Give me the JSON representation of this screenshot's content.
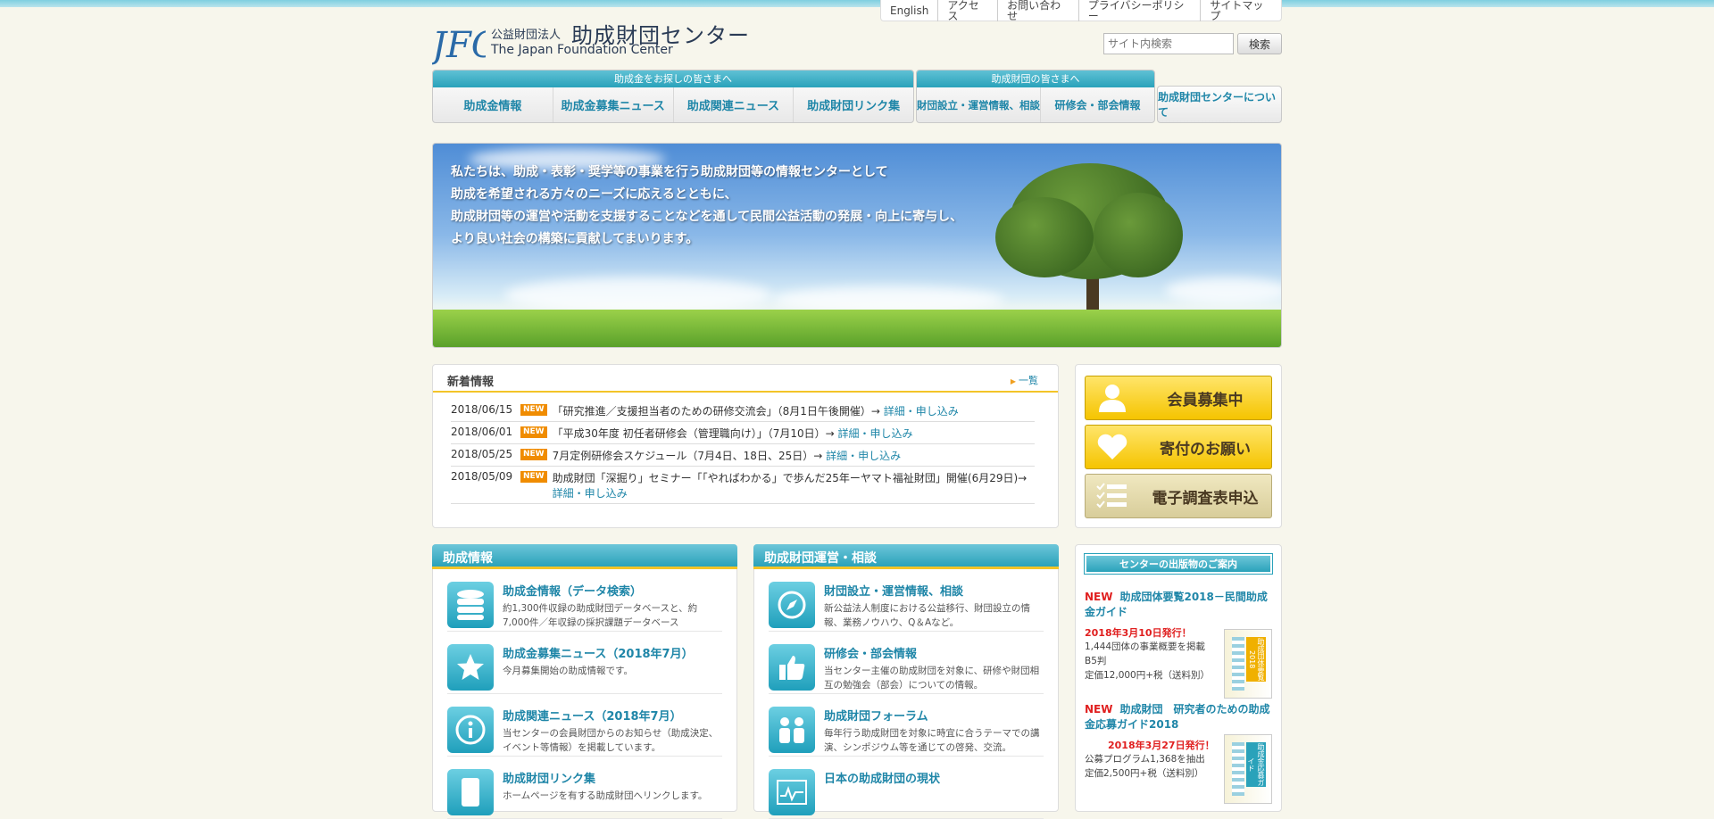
{
  "header": {
    "logo_mark": "JFC",
    "org_small": "公益財団法人",
    "org_name": "助成財団センター",
    "org_en": "The Japan Foundation Center",
    "utility_links": [
      "English",
      "アクセス",
      "お問い合わせ",
      "プライバシーポリシー",
      "サイトマップ"
    ],
    "search_placeholder": "サイト内検索",
    "search_button": "検索"
  },
  "nav": {
    "group1_caption": "助成金をお探しの皆さまへ",
    "group1_items": [
      "助成金情報",
      "助成金募集ニュース",
      "助成関連ニュース",
      "助成財団リンク集"
    ],
    "group2_caption": "助成財団の皆さまへ",
    "group2_items": [
      "財団設立・運営情報、相談",
      "研修会・部会情報"
    ],
    "about": "助成財団センターについて"
  },
  "hero": {
    "lines": [
      "私たちは、助成・表彰・奨学等の事業を行う助成財団等の情報センターとして",
      "助成を希望される方々のニーズに応えるとともに、",
      "助成財団等の運営や活動を支援することなどを通して民間公益活動の発展・向上に寄与し、",
      "より良い社会の構築に貢献してまいります。"
    ]
  },
  "news": {
    "title": "新着情報",
    "more": "一覧",
    "new_label": "NEW",
    "items": [
      {
        "date": "2018/06/15",
        "text": "「研究推進／支援担当者のための研修交流会」（8月1日午後開催）→",
        "link": "詳細・申し込み"
      },
      {
        "date": "2018/06/01",
        "text": "「平成30年度 初任者研修会（管理職向け）」（7月10日）→",
        "link": "詳細・申し込み"
      },
      {
        "date": "2018/05/25",
        "text": "7月定例研修会スケジュール（7月4日、18日、25日）→",
        "link": "詳細・申し込み"
      },
      {
        "date": "2018/05/09",
        "text": "助成財団「深掘り」セミナー「「やればわかる」で歩んだ25年ーヤマト福祉財団」開催(6月29日)→",
        "link": "詳細・申し込み"
      }
    ]
  },
  "side_buttons": [
    "会員募集中",
    "寄付のお願い",
    "電子調査表申込"
  ],
  "section_grant": {
    "title": "助成情報",
    "entries": [
      {
        "title": "助成金情報（データ検索）",
        "desc": "約1,300件収録の助成財団データベースと、約7,000件／年収録の採択課題データベース"
      },
      {
        "title": "助成金募集ニュース（2018年7月）",
        "desc": "今月募集開始の助成情報です。"
      },
      {
        "title": "助成関連ニュース（2018年7月）",
        "desc": "当センターの会員財団からのお知らせ（助成決定、イベント等情報）を掲載しています。"
      },
      {
        "title": "助成財団リンク集",
        "desc": "ホームページを有する助成財団へリンクします。"
      }
    ]
  },
  "section_ops": {
    "title": "助成財団運営・相談",
    "entries": [
      {
        "title": "財団設立・運営情報、相談",
        "desc": "新公益法人制度における公益移行、財団設立の情報、業務ノウハウ、Q＆Aなど。"
      },
      {
        "title": "研修会・部会情報",
        "desc": "当センター主催の助成財団を対象に、研修や財団相互の勉強会（部会）についての情報。"
      },
      {
        "title": "助成財団フォーラム",
        "desc": "毎年行う助成財団を対象に時宜に合うテーマでの講演、シンポジウム等を通じての啓発、交流。"
      },
      {
        "title": "日本の助成財団の現状",
        "desc": ""
      }
    ]
  },
  "publications": {
    "title": "センターの出版物のご案内",
    "new_label": "NEW",
    "items": [
      {
        "title": "助成団体要覧2018－民間助成金ガイド",
        "release": "2018年3月10日発行！",
        "details": [
          "1,444団体の事業概要を掲載",
          "B5判",
          "定価12,000円+税（送料別）"
        ],
        "cover": "助成団体要覧2018"
      },
      {
        "title": "助成財団　研究者のための助成金応募ガイド2018",
        "release": "2018年3月27日発行！",
        "details": [
          "公募プログラム1,368を抽出",
          "定価2,500円+税（送料別）"
        ],
        "cover": "助成金応募ガイド"
      }
    ]
  },
  "colors": {
    "accent": "#2aa2ba",
    "link": "#1f86a8",
    "yellow": "#f5c400",
    "new_badge": "#f08c00",
    "new_text": "#e02020"
  }
}
